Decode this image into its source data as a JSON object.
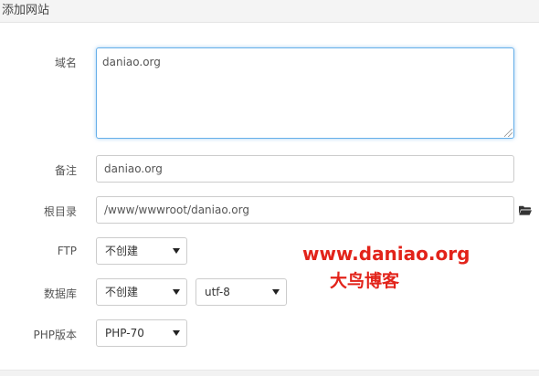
{
  "dialog": {
    "title": "添加网站"
  },
  "form": {
    "domain": {
      "label": "域名",
      "value": "daniao.org"
    },
    "remark": {
      "label": "备注",
      "value": "daniao.org"
    },
    "root": {
      "label": "根目录",
      "value": "/www/wwwroot/daniao.org",
      "icon": "folder-open-icon"
    },
    "ftp": {
      "label": "FTP",
      "selected": "不创建"
    },
    "database": {
      "label": "数据库",
      "selected": "不创建",
      "charset": "utf-8"
    },
    "php": {
      "label": "PHP版本",
      "selected": "PHP-70"
    }
  },
  "watermark": {
    "url": "www.daniao.org",
    "name": "大鸟博客",
    "color": "#e2231a"
  },
  "colors": {
    "focus_border": "#66afe9",
    "border": "#cccccc"
  }
}
